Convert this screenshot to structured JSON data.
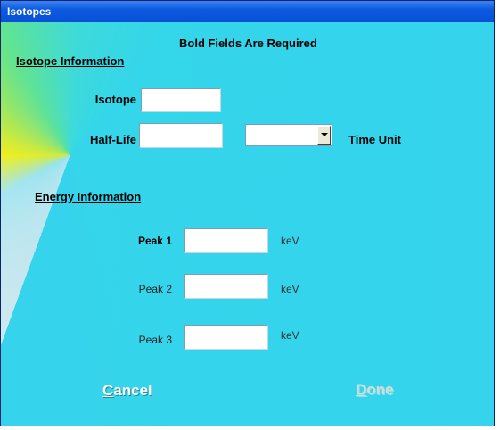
{
  "window": {
    "title": "Isotopes"
  },
  "header": {
    "required_note": "Bold Fields Are Required"
  },
  "isotope_section": {
    "heading": "Isotope Information",
    "isotope_label": "Isotope",
    "isotope_value": "",
    "half_life_label": "Half-Life",
    "half_life_value": "",
    "time_unit_selected": "",
    "time_unit_label": "Time Unit"
  },
  "energy_section": {
    "heading": "Energy Information",
    "peaks": [
      {
        "label": "Peak 1",
        "value": "",
        "unit": "keV",
        "required": true
      },
      {
        "label": "Peak 2",
        "value": "",
        "unit": "keV",
        "required": false
      },
      {
        "label": "Peak 3",
        "value": "",
        "unit": "keV",
        "required": false
      }
    ]
  },
  "buttons": {
    "cancel_label": "Cancel",
    "cancel_mnemonic": "C",
    "done_label": "Done",
    "done_mnemonic": "D",
    "done_enabled": false
  },
  "colors": {
    "title_bar": "#0b5ae0",
    "background_main": "#35d4ec",
    "disabled_text": "#d9dad4"
  }
}
